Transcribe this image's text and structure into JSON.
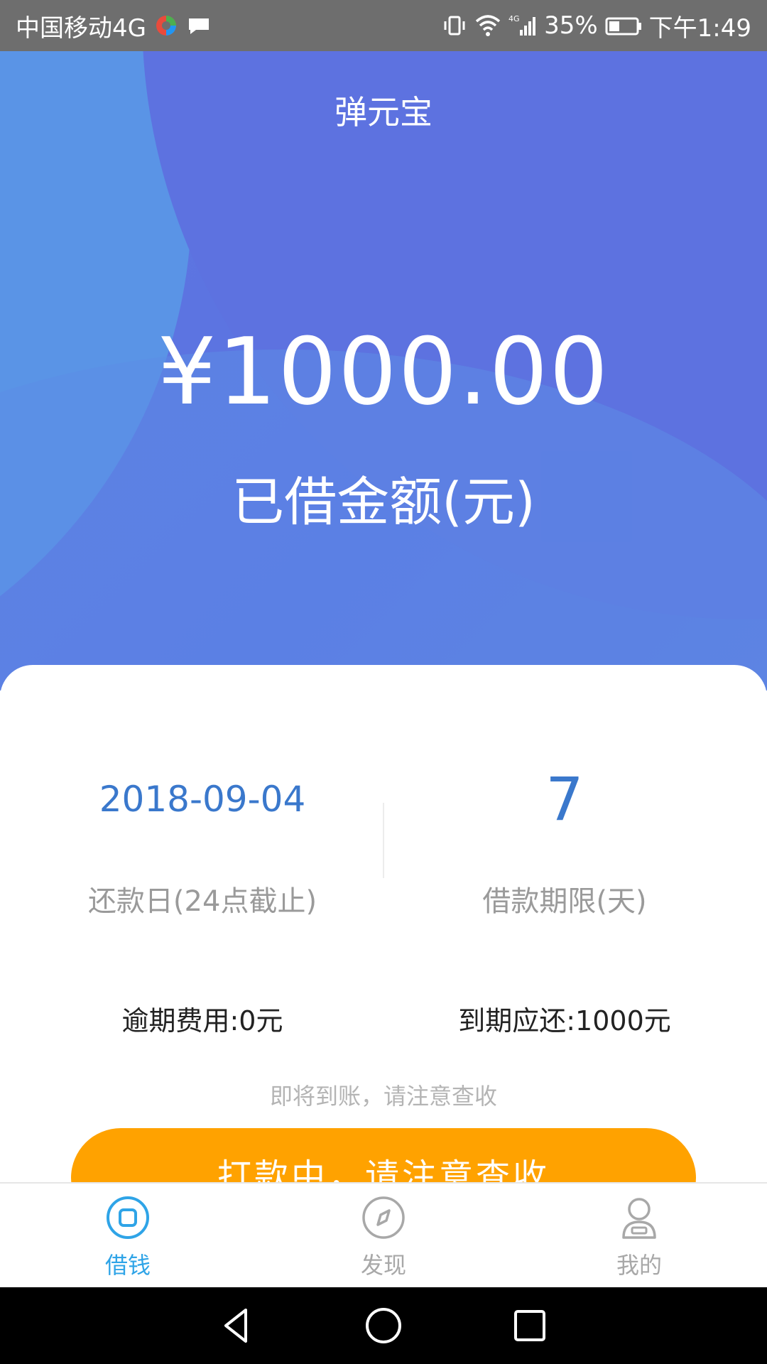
{
  "status_bar": {
    "carrier": "中国移动4G",
    "battery_percent": "35%",
    "time": "下午1:49",
    "network": "4G"
  },
  "header": {
    "title": "弹元宝"
  },
  "loan": {
    "amount": "¥1000.00",
    "amount_label": "已借金额(元)",
    "repay_date": "2018-09-04",
    "repay_date_label": "还款日(24点截止)",
    "term_days": "7",
    "term_label": "借款期限(天)",
    "overdue_fee": "逾期费用:0元",
    "due_amount": "到期应还:1000元",
    "notice": "即将到账，请注意查收",
    "button_label": "打款中，请注意查收"
  },
  "bottom_nav": {
    "items": [
      {
        "label": "借钱",
        "icon": "borrow-icon",
        "active": true
      },
      {
        "label": "发现",
        "icon": "compass-icon",
        "active": false
      },
      {
        "label": "我的",
        "icon": "profile-icon",
        "active": false
      }
    ]
  },
  "colors": {
    "accent": "#3a78cc",
    "button": "#ffa200",
    "nav_active": "#2fa4e7",
    "hero": "#5a71e2"
  }
}
